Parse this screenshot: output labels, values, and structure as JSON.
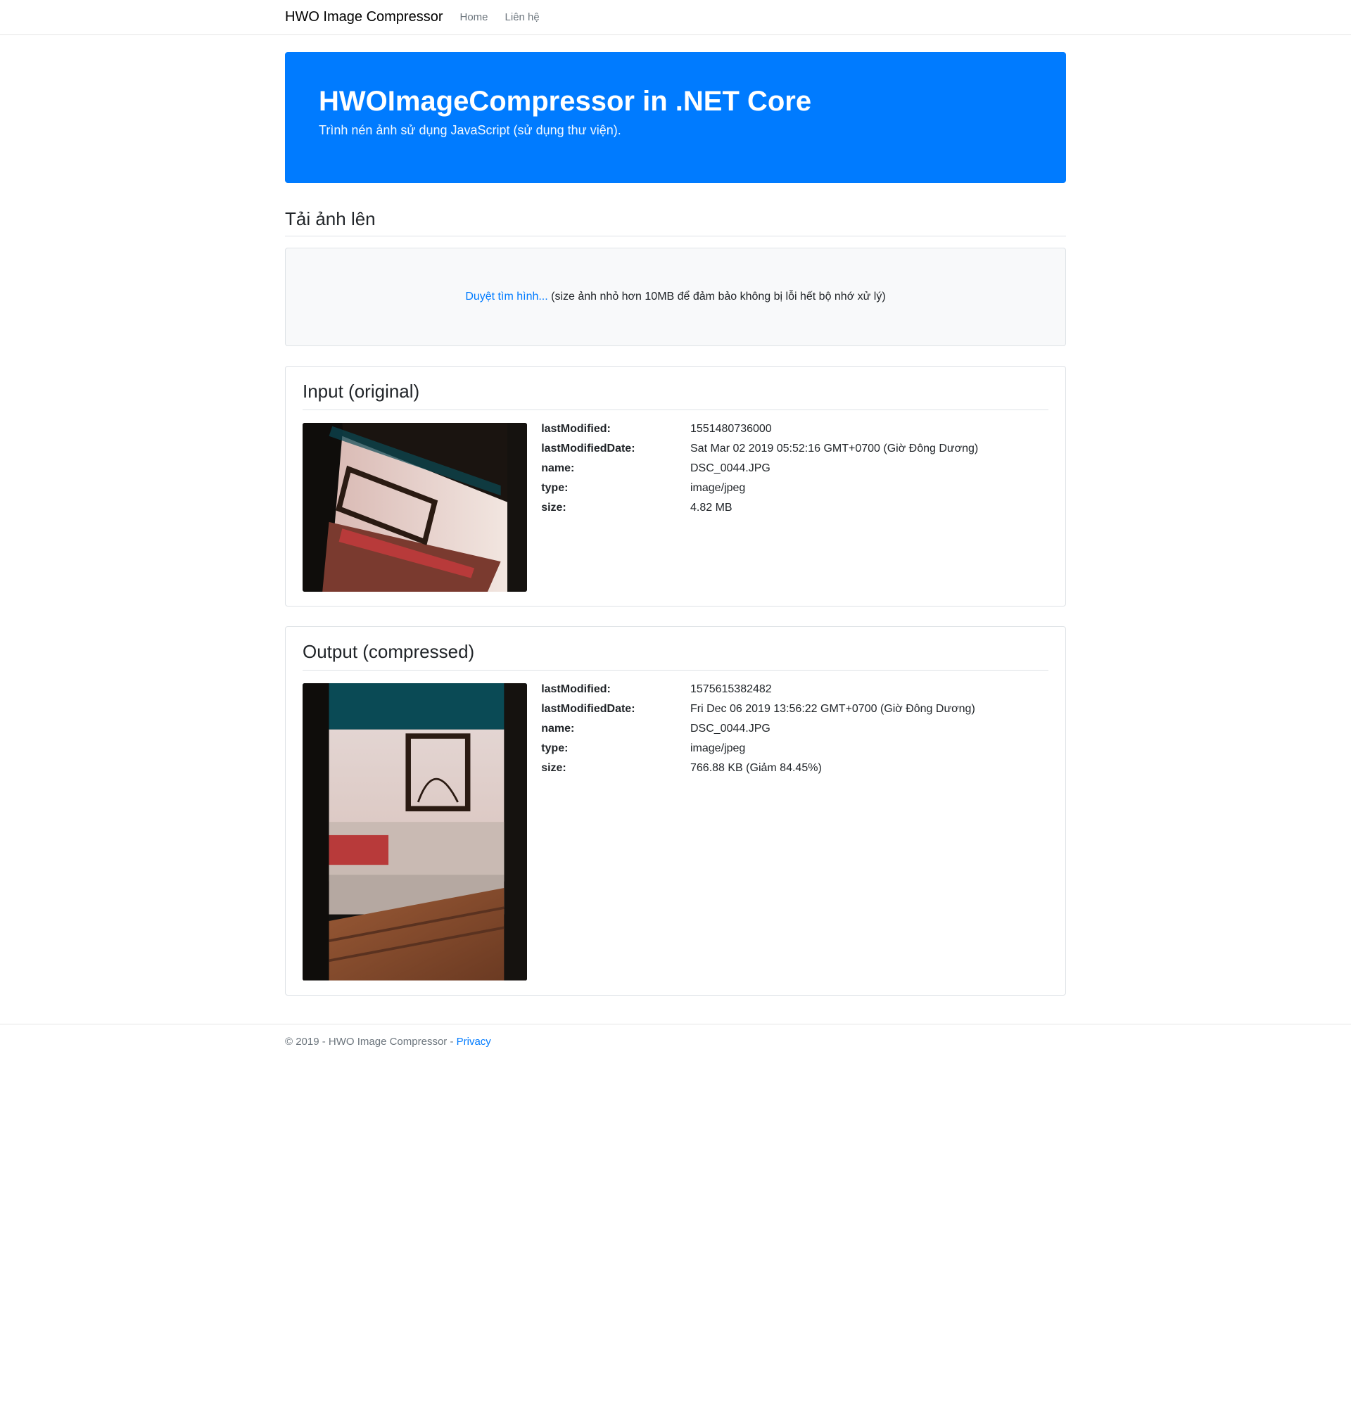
{
  "nav": {
    "brand": "HWO Image Compressor",
    "links": [
      {
        "label": "Home"
      },
      {
        "label": "Liên hệ"
      }
    ]
  },
  "hero": {
    "title": "HWOImageCompressor in .NET Core",
    "subtitle": "Trình nén ảnh sử dụng JavaScript (sử dụng thư viện)."
  },
  "upload": {
    "heading": "Tải ảnh lên",
    "browse_label": "Duyệt tìm hình...",
    "hint": " (size ảnh nhỏ hơn 10MB để đảm bảo không bị lỗi hết bộ nhớ xử lý)"
  },
  "labels": {
    "lastModified": "lastModified:",
    "lastModifiedDate": "lastModifiedDate:",
    "name": "name:",
    "type": "type:",
    "size": "size:"
  },
  "input_panel": {
    "title": "Input (original)",
    "lastModified": "1551480736000",
    "lastModifiedDate": "Sat Mar 02 2019 05:52:16 GMT+0700 (Giờ Đông Dương)",
    "name": "DSC_0044.JPG",
    "type": "image/jpeg",
    "size": "4.82 MB"
  },
  "output_panel": {
    "title": "Output (compressed)",
    "lastModified": "1575615382482",
    "lastModifiedDate": "Fri Dec 06 2019 13:56:22 GMT+0700 (Giờ Đông Dương)",
    "name": "DSC_0044.JPG",
    "type": "image/jpeg",
    "size": "766.88 KB (Giảm 84.45%)"
  },
  "footer": {
    "text": "© 2019 - HWO Image Compressor - ",
    "privacy": "Privacy"
  }
}
